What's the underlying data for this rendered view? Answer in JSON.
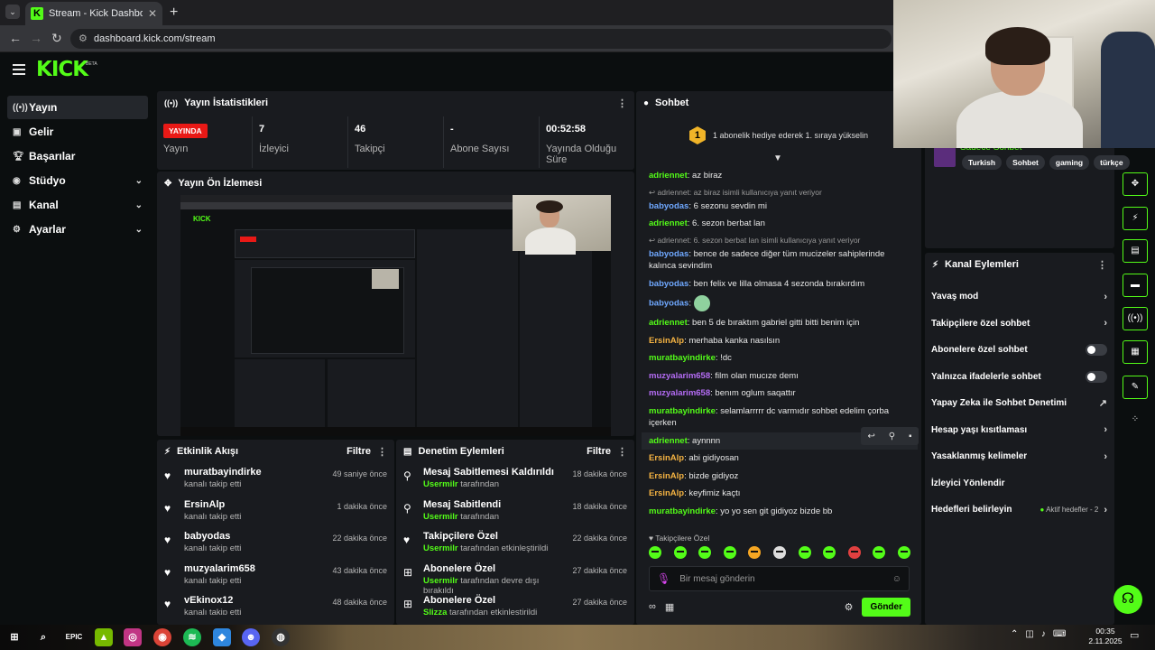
{
  "browser": {
    "tab_title": "Stream - Kick Dashboard",
    "url": "dashboard.kick.com/stream",
    "tab_close": "✕",
    "new_tab": "+"
  },
  "brand": {
    "logo": "KICK",
    "badge": "BETA",
    "accent": "#53fc18"
  },
  "sidebar": {
    "items": [
      {
        "label": "Yayın",
        "icon": "broadcast-icon",
        "active": true,
        "expandable": false
      },
      {
        "label": "Gelir",
        "icon": "money-icon",
        "active": false,
        "expandable": false
      },
      {
        "label": "Başarılar",
        "icon": "trophy-icon",
        "active": false,
        "expandable": false
      },
      {
        "label": "Stüdyo",
        "icon": "studio-icon",
        "active": false,
        "expandable": true
      },
      {
        "label": "Kanal",
        "icon": "channel-icon",
        "active": false,
        "expandable": true
      },
      {
        "label": "Ayarlar",
        "icon": "gear-icon",
        "active": false,
        "expandable": true
      }
    ]
  },
  "stats": {
    "title": "Yayın İstatistikleri",
    "live_badge": "YAYINDA",
    "items": [
      {
        "value": "",
        "label": "Yayın"
      },
      {
        "value": "7",
        "label": "İzleyici"
      },
      {
        "value": "46",
        "label": "Takipçi"
      },
      {
        "value": "-",
        "label": "Abone Sayısı"
      },
      {
        "value": "00:52:58",
        "label": "Yayında Olduğu Süre"
      }
    ]
  },
  "preview": {
    "title": "Yayın Ön İzlemesi"
  },
  "events": {
    "title": "Etkinlik Akışı",
    "filter": "Filtre",
    "items": [
      {
        "user": "muratbayindirke",
        "action": "kanalı takip etti",
        "time": "49 saniye önce"
      },
      {
        "user": "ErsinAlp",
        "action": "kanalı takip etti",
        "time": "1 dakika önce"
      },
      {
        "user": "babyodas",
        "action": "kanalı takip etti",
        "time": "22 dakika önce"
      },
      {
        "user": "muzyalarim658",
        "action": "kanalı takip etti",
        "time": "43 dakika önce"
      },
      {
        "user": "vEkinox12",
        "action": "kanalı takip etti",
        "time": "48 dakika önce"
      }
    ]
  },
  "modlog": {
    "title": "Denetim Eylemleri",
    "filter": "Filtre",
    "items": [
      {
        "title": "Mesaj Sabitlemesi Kaldırıldı",
        "actor": "Usermilr",
        "rest": "tarafından",
        "time": "18 dakika önce",
        "icon": "unpin-icon"
      },
      {
        "title": "Mesaj Sabitlendi",
        "actor": "Usermilr",
        "rest": "tarafından",
        "time": "18 dakika önce",
        "icon": "pin-icon"
      },
      {
        "title": "Takipçilere Özel",
        "actor": "Usermilr",
        "rest": "tarafından etkinleştirildi",
        "time": "22 dakika önce",
        "icon": "heart-icon"
      },
      {
        "title": "Abonelere Özel",
        "actor": "Usermilr",
        "rest": "tarafından devre dışı bırakıldı",
        "time": "27 dakika önce",
        "icon": "gift-icon"
      },
      {
        "title": "Abonelere Özel",
        "actor": "Slizza",
        "rest": "tarafından etkinleştirildi",
        "time": "27 dakika önce",
        "icon": "gift-icon"
      }
    ]
  },
  "chat": {
    "title": "Sohbet",
    "gift_text": "1 abonelik hediye ederek 1. sıraya yükselin",
    "gift_rank": "1",
    "messages": [
      {
        "user": "adriennet",
        "color": "#53fc18",
        "text": "az biraz"
      },
      {
        "reply": "adriennet: az biraz isimli kullanıcıya yanıt veriyor",
        "user": "babyodas",
        "color": "#6fa8ff",
        "text": "6 sezonu sevdin mi"
      },
      {
        "user": "adriennet",
        "color": "#53fc18",
        "text": "6. sezon berbat lan"
      },
      {
        "reply": "adriennet: 6. sezon berbat lan isimli kullanıcıya yanıt veriyor",
        "user": "babyodas",
        "color": "#6fa8ff",
        "text": "bence de sadece diğer tüm mucizeler sahiplerinde kalınca sevindim"
      },
      {
        "user": "babyodas",
        "color": "#6fa8ff",
        "text": "ben felix ve lilla olmasa 4 sezonda bırakırdım"
      },
      {
        "user": "babyodas",
        "color": "#6fa8ff",
        "text": "",
        "emote": true
      },
      {
        "user": "adriennet",
        "color": "#53fc18",
        "text": "ben 5 de bıraktım gabriel gitti bitti benim için"
      },
      {
        "user": "ErsinAlp",
        "color": "#f5b342",
        "text": "merhaba kanka nasılsın"
      },
      {
        "user": "muratbayindirke",
        "color": "#53fc18",
        "text": "!dc"
      },
      {
        "user": "muzyalarim658",
        "color": "#b56cf5",
        "text": "film olan mucıze demı"
      },
      {
        "user": "muzyalarim658",
        "color": "#b56cf5",
        "text": "benım oglum saqattır"
      },
      {
        "user": "muratbayindirke",
        "color": "#53fc18",
        "text": "selamlarrrrr dc varmıdır sohbet edelim çorba içerken"
      },
      {
        "user": "adriennet",
        "color": "#53fc18",
        "text": "aynnnn",
        "highlight": true
      },
      {
        "user": "ErsinAlp",
        "color": "#f5b342",
        "text": "abi gidiyosan"
      },
      {
        "user": "ErsinAlp",
        "color": "#f5b342",
        "text": "bizde gidiyoz"
      },
      {
        "user": "ErsinAlp",
        "color": "#f5b342",
        "text": "keyfimiz kaçtı"
      },
      {
        "user": "muratbayindirke",
        "color": "#53fc18",
        "text": "yo yo sen git gidiyoz bizde bb"
      }
    ],
    "followers_only": "Takipçilere Özel",
    "input_placeholder": "Bir mesaj gönderin",
    "send": "Gönder"
  },
  "channel": {
    "name": "Sadece Sohbet",
    "tags": [
      "Turkish",
      "Sohbet",
      "gaming",
      "türkçe"
    ]
  },
  "actions": {
    "title": "Kanal Eylemleri",
    "items": [
      {
        "label": "Yavaş mod",
        "kind": "chevron"
      },
      {
        "label": "Takipçilere özel sohbet",
        "kind": "chevron"
      },
      {
        "label": "Abonelere özel sohbet",
        "kind": "toggle"
      },
      {
        "label": "Yalnızca ifadelerle sohbet",
        "kind": "toggle"
      },
      {
        "label": "Yapay Zeka ile Sohbet Denetimi",
        "kind": "external"
      },
      {
        "label": "Hesap yaşı kısıtlaması",
        "kind": "chevron"
      },
      {
        "label": "Yasaklanmış kelimeler",
        "kind": "chevron"
      },
      {
        "label": "İzleyici Yönlendir",
        "kind": "none"
      },
      {
        "label": "Hedefleri belirleyin",
        "kind": "goal",
        "goal": "Aktif hedefler - 2"
      }
    ]
  },
  "taskbar": {
    "time": "00:35",
    "date": "2.11.2025"
  }
}
